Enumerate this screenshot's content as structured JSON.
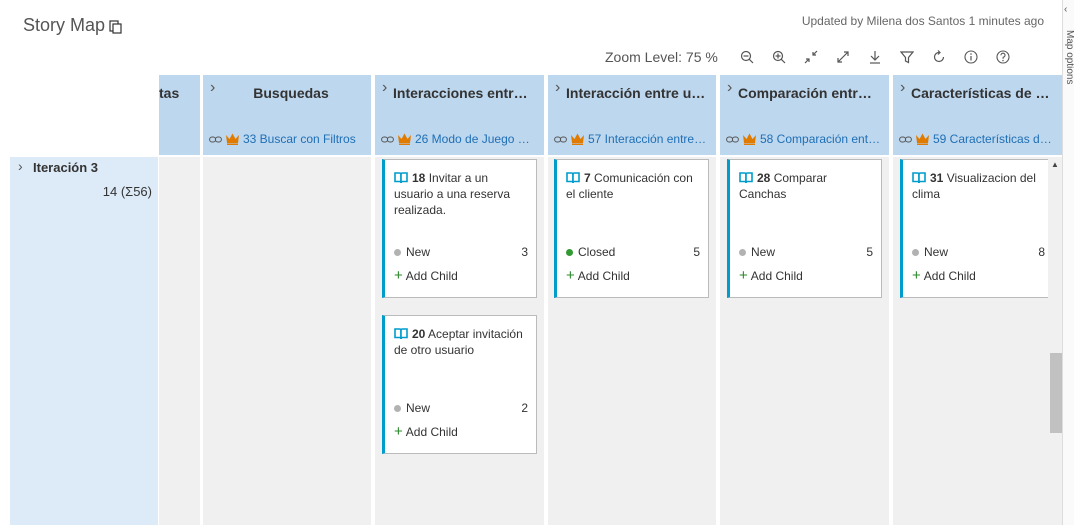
{
  "page": {
    "title": "Story Map",
    "updated_text": "Updated by Milena dos Santos 1 minutes ago"
  },
  "toolbar": {
    "zoom_label": "Zoom Level: 75 %",
    "buttons": [
      "zoom-out-icon",
      "zoom-in-icon",
      "collapse-icon",
      "expand-icon",
      "download-icon",
      "filter-icon",
      "refresh-icon",
      "info-icon",
      "help-icon"
    ]
  },
  "side_panel": {
    "label": "Map options"
  },
  "columns": [
    {
      "name": "tas",
      "link": ""
    },
    {
      "name": "Busquedas",
      "link": "33 Buscar con Filtros"
    },
    {
      "name": "Interacciones entre …",
      "link": "26 Modo de Juego …"
    },
    {
      "name": "Interacción entre us…",
      "link": "57 Interacción entre…"
    },
    {
      "name": "Comparación entre …",
      "link": "58 Comparación ent…"
    },
    {
      "name": "Características de im…",
      "link": "59 Características de…"
    }
  ],
  "iteration": {
    "name": "Iteración 3",
    "stat": "14 (Σ56)"
  },
  "cards": [
    {
      "id": "18",
      "title": "Invitar a un usuario a una reserva realizada.",
      "state": "New",
      "state_color": "#b2b2b2",
      "points": "3",
      "add_label": "Add Child"
    },
    {
      "id": "20",
      "title": "Aceptar invitación de otro usuario",
      "state": "New",
      "state_color": "#b2b2b2",
      "points": "2",
      "add_label": "Add Child"
    },
    {
      "id": "7",
      "title": "Comunicación con el cliente",
      "state": "Closed",
      "state_color": "#339933",
      "points": "5",
      "add_label": "Add Child"
    },
    {
      "id": "28",
      "title": "Comparar Canchas",
      "state": "New",
      "state_color": "#b2b2b2",
      "points": "5",
      "add_label": "Add Child"
    },
    {
      "id": "31",
      "title": "Visualizacion del clima",
      "state": "New",
      "state_color": "#b2b2b2",
      "points": "8",
      "add_label": "Add Child"
    }
  ],
  "colors": {
    "header_bg": "#bdd7ee",
    "iteration_bg": "#ddeaf7",
    "card_accent": "#009ccc",
    "link": "#1f6fb5",
    "crown": "#e07b00"
  }
}
